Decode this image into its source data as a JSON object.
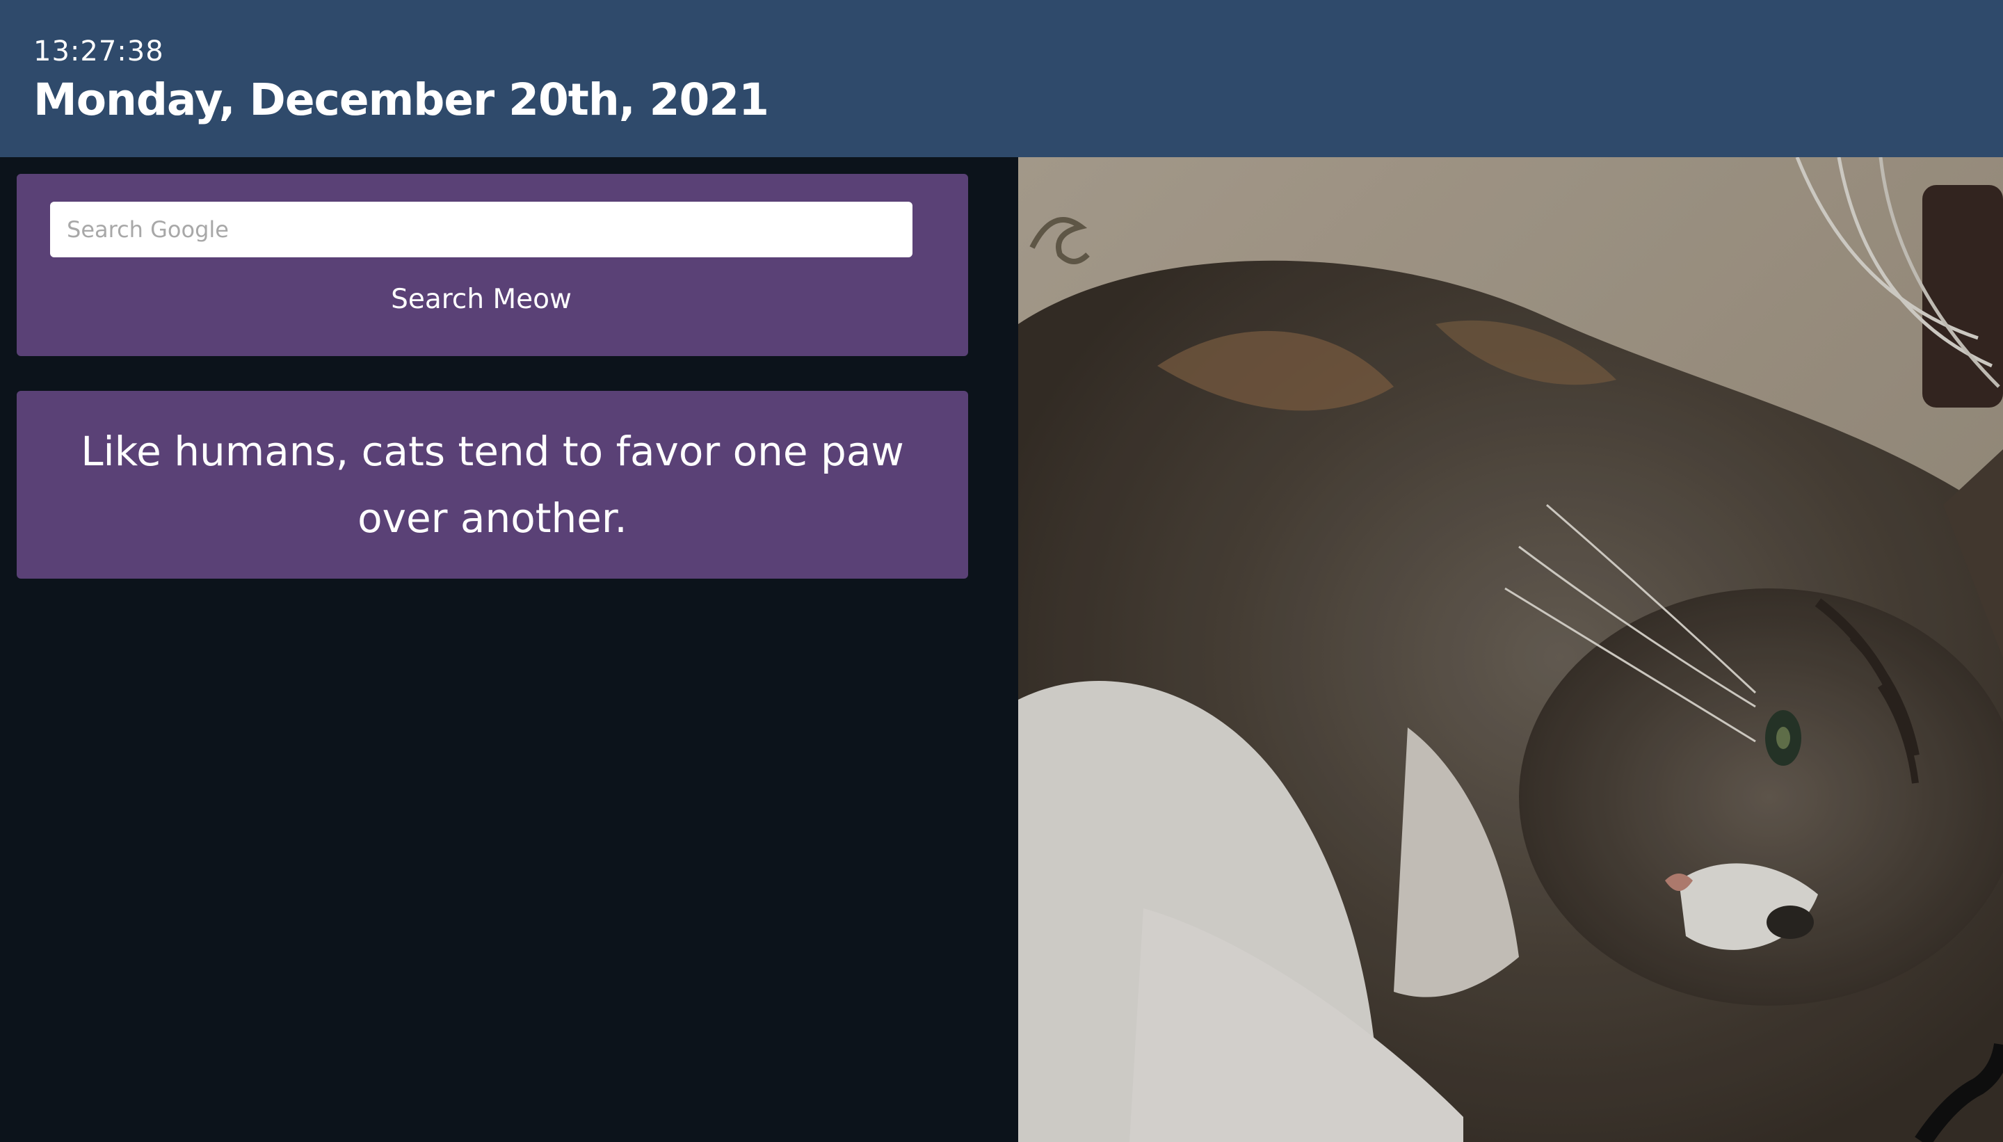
{
  "header": {
    "time": "13:27:38",
    "date": "Monday, December 20th, 2021"
  },
  "search": {
    "placeholder": "Search Google",
    "button_label": "Search Meow"
  },
  "fact": {
    "text": "Like humans, cats tend to favor one paw over another."
  },
  "colors": {
    "header_bg": "#2f4a6b",
    "page_bg": "#0c131b",
    "card_bg": "#5a4176",
    "text": "#ffffff"
  },
  "photo": {
    "subject": "cat-photo"
  }
}
